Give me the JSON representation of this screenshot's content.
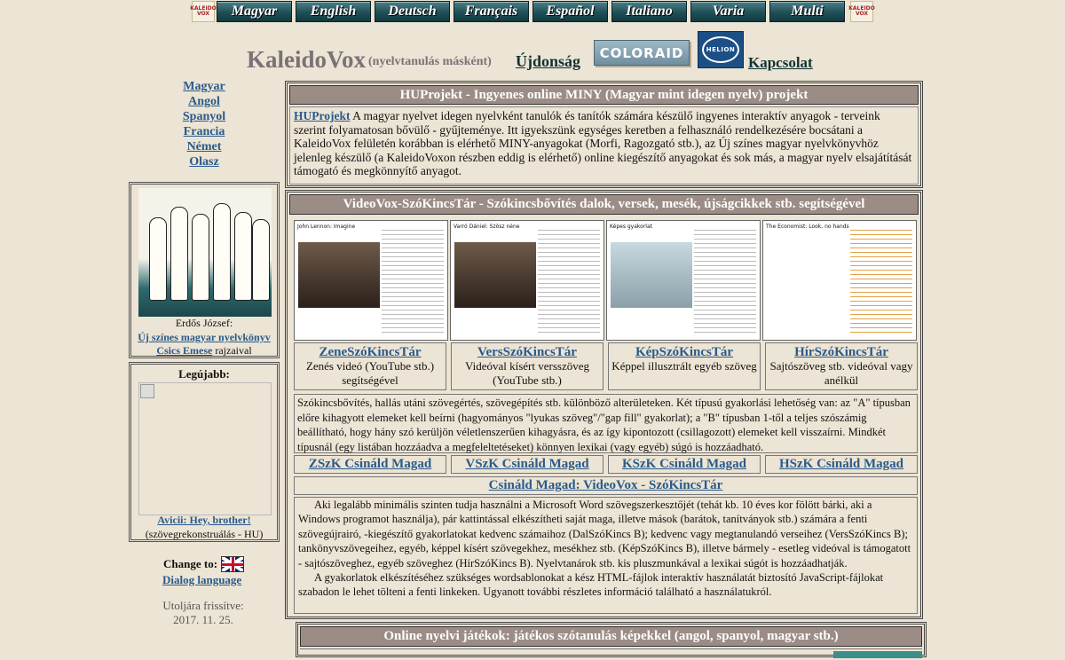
{
  "topnav": {
    "logo_text": "KALEIDO VOX",
    "languages": [
      "Magyar",
      "English",
      "Deutsch",
      "Français",
      "Español",
      "Italiano",
      "Varia",
      "Multi"
    ]
  },
  "header": {
    "title": "KaleidoVox",
    "subtitle": "(nyelvtanulás másként)",
    "news_link": "Újdonság",
    "coloraid_label": "COLORAID",
    "helion_label": "HELION",
    "contact_link": "Kapcsolat"
  },
  "sidebar": {
    "lang_links": [
      "Magyar",
      "Angol",
      "Spanyol",
      "Francia",
      "Német",
      "Olasz"
    ],
    "book_author": "Erdős József:",
    "book_title_link": "Új színes magyar nyelvkönyv",
    "illustrator_link": "Csics Emese",
    "illustrator_suffix": "rajzaival",
    "latest_header": "Legújabb:",
    "latest_link": "Avicii: Hey, brother!",
    "latest_sub": "(szövegrekonstruálás - HU)",
    "change_to": "Change to:",
    "dialog_language": "Dialog language",
    "updated_label": "Utoljára frissítve:",
    "updated_date": "2017. 11. 25."
  },
  "huprojekt": {
    "title": "HUProjekt - Ingyenes online MINY (Magyar mint idegen nyelv) projekt",
    "link": "HUProjekt",
    "body": "A magyar nyelvet idegen nyelvként tanulók és tanítók számára készülő ingyenes interaktív anyagok - terveink szerint folyamatosan bővülő - gyűjteménye. Itt igyekszünk egységes keretben a felhasználó rendelkezésére bocsátani a KaleidoVox felületén korábban is elérhető MINY-anyagokat (Morfi, Ragozgató stb.), az Új színes magyar nyelvkönyvhöz jelenleg készülő (a KaleidoVoxon részben eddig is elérhető) online kiegészítő anyagokat és sok más, a magyar nyelv elsajátítását támogató és megkönnyítő anyagot."
  },
  "videovox": {
    "title": "VideoVox-SzóKincsTár - Szókincsbővítés dalok, versek, mesék, újságcikkek stb. segítségével",
    "thumb_captions": [
      "John Lennon: Imagine",
      "Varró Dániel: Szösz néne",
      "Képes gyakorlat",
      "The Economist: Look, no hands"
    ],
    "cells": [
      {
        "link": "ZeneSzóKincsTár",
        "desc": "Zenés videó (YouTube stb.) segítségével"
      },
      {
        "link": "VersSzóKincsTár",
        "desc": "Videóval kísért versszöveg (YouTube stb.)"
      },
      {
        "link": "KépSzóKincsTár",
        "desc": "Képpel illusztrált egyéb szöveg"
      },
      {
        "link": "HírSzóKincsTár",
        "desc": "Sajtószöveg stb. videóval vagy anélkül"
      }
    ],
    "description": "Szókincsbővítés, hallás utáni szövegértés, szövegépítés stb. különböző alterületeken. Két típusú gyakorlási lehetőség van: az \"A\" típusban előre kihagyott elemeket kell beírni (hagyományos \"lyukas szöveg\"/\"gap fill\" gyakorlat); a \"B\" típusban 1-től a teljes szószámig beállítható, hogy hány szó kerüljön véletlenszerűen kihagyásra, és az így kipontozott (csillagozott) elemeket kell visszaírni. Mindkét típusnál (egy listában hozzáadva a megfeleltetéseket) könnyen lexikai (vagy egyéb) súgó is hozzáadható.",
    "make_links": [
      "ZSzK Csináld Magad",
      "VSzK Csináld Magad",
      "KSzK Csináld Magad",
      "HSzK Csináld Magad"
    ],
    "make_header": "Csináld Magad: VideoVox - SzóKincsTár",
    "make_p1": "Aki legalább minimális szinten tudja használni a Microsoft Word szövegszerkesztőjét (tehát kb. 10 éves kor fölött bárki, aki a Windows programot használja), pár kattintással elkészítheti saját maga, illetve mások (barátok, tanítványok stb.) számára a fenti szövegújrairó, -kiegészítő gyakorlatokat kedvenc számaihoz (DalSzóKincs B); kedvenc vagy megtanulandó verseihez (VersSzóKincs B); tankönyvszövegeihez, egyéb, képpel kísért szövegekhez, mesékhez stb. (KépSzóKincs B), illetve bármely - esetleg videóval is támogatott - sajtószöveghez, egyéb szöveghez (HírSzóKincs B). Nyelvtanárok stb. kis pluszmunkával a lexikai súgót is hozzáadhatják.",
    "make_p2": "A gyakorlatok elkészítéséhez szükséges wordsablonokat a kész HTML-fájlok interaktív használatát biztosító JavaScript-fájlokat szabadon le lehet tölteni a fenti linkeken. Ugyanott további részletes információ található a használatukról."
  },
  "games": {
    "title": "Online nyelvi játékok: játékos szótanulás képekkel (angol, spanyol, magyar stb.)"
  },
  "colors": {
    "background": "#ece4d4",
    "panel_header": "#9b8c86",
    "link": "#2a5a8a",
    "lang_button": "#1f4f57"
  }
}
